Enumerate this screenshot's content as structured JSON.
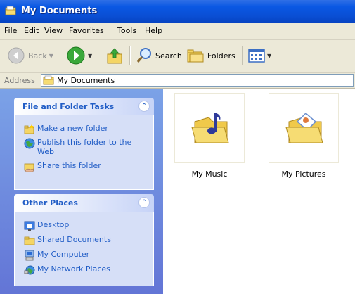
{
  "window": {
    "title": "My Documents"
  },
  "menu": [
    "File",
    "Edit",
    "View",
    "Favorites",
    "Tools",
    "Help"
  ],
  "toolbar": {
    "back": "Back",
    "search": "Search",
    "folders": "Folders"
  },
  "address": {
    "label": "Address",
    "value": "My Documents"
  },
  "tasks": {
    "title": "File and Folder Tasks",
    "items": [
      {
        "label": "Make a new folder",
        "icon": "new-folder-icon"
      },
      {
        "label": "Publish this folder to the Web",
        "icon": "publish-web-icon"
      },
      {
        "label": "Share this folder",
        "icon": "share-folder-icon"
      }
    ]
  },
  "places": {
    "title": "Other Places",
    "items": [
      {
        "label": "Desktop",
        "icon": "desktop-icon"
      },
      {
        "label": "Shared Documents",
        "icon": "folder-icon"
      },
      {
        "label": "My Computer",
        "icon": "computer-icon"
      },
      {
        "label": "My Network Places",
        "icon": "network-icon"
      }
    ]
  },
  "files": [
    {
      "label": "My Music",
      "icon": "music-folder-icon"
    },
    {
      "label": "My Pictures",
      "icon": "pictures-folder-icon"
    }
  ],
  "colors": {
    "titlebar": "#0a58e3",
    "taskpane": "#6f8ede",
    "link": "#215dc6"
  }
}
